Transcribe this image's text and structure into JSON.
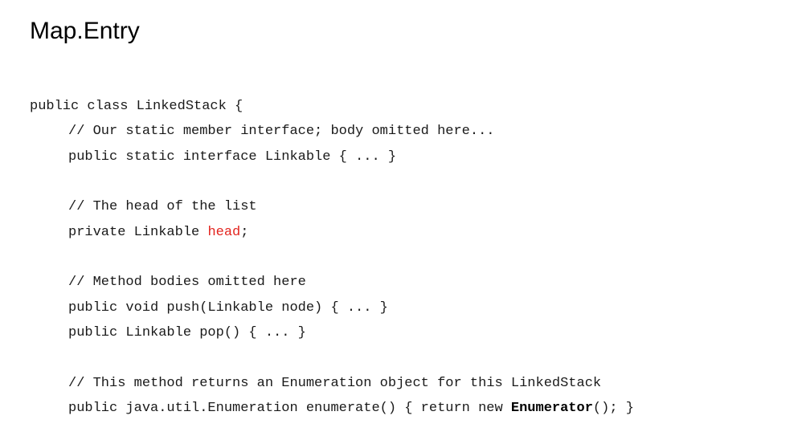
{
  "slide": {
    "title": "Map.Entry",
    "code": {
      "line1": "public class LinkedStack {",
      "line2": "// Our static member interface; body omitted here...",
      "line3": "public static interface Linkable { ... }",
      "line5": "// The head of the list",
      "line6_before": "private Linkable ",
      "line6_highlight": "head",
      "line6_after": ";",
      "line8": "// Method bodies omitted here",
      "line9": "public void push(Linkable node) { ... }",
      "line10": "public Linkable pop() { ... }",
      "line12": "// This method returns an Enumeration object for this LinkedStack",
      "line13_before": "public java.util.Enumeration enumerate() { return new ",
      "line13_bold": "Enumerator",
      "line13_after": "(); }"
    },
    "colors": {
      "highlight_red": "#e3251f",
      "text": "#1a1a1a"
    }
  }
}
